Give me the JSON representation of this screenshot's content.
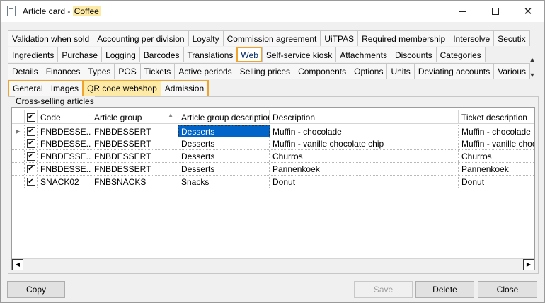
{
  "window": {
    "title_prefix": "Article card - ",
    "title_highlight": "Coffee"
  },
  "tabs": {
    "row1": [
      "Validation when sold",
      "Accounting per division",
      "Loyalty",
      "Commission agreement",
      "UiTPAS",
      "Required membership",
      "Intersolve",
      "Secutix"
    ],
    "row2": [
      "Ingredients",
      "Purchase",
      "Logging",
      "Barcodes",
      "Translations",
      "Web",
      "Self-service kiosk",
      "Attachments",
      "Discounts",
      "Categories"
    ],
    "row3": [
      "Details",
      "Finances",
      "Types",
      "POS",
      "Tickets",
      "Active periods",
      "Selling prices",
      "Components",
      "Options",
      "Units",
      "Deviating accounts",
      "Various"
    ],
    "active": "Web"
  },
  "subtabs": {
    "items": [
      "General",
      "Images",
      "QR code webshop",
      "Admission"
    ],
    "selected": "QR code webshop"
  },
  "group_label": "Cross-selling articles",
  "grid": {
    "columns": [
      "Code",
      "Article group",
      "Article group description",
      "Description",
      "Ticket description"
    ],
    "rows": [
      {
        "code": "FNBDESSE...",
        "group": "FNBDESSERT",
        "group_desc": "Desserts",
        "description": "Muffin - chocolade",
        "ticket": "Muffin - chocolade",
        "checked": true
      },
      {
        "code": "FNBDESSE...",
        "group": "FNBDESSERT",
        "group_desc": "Desserts",
        "description": "Muffin -  vanille chocolate chip",
        "ticket": "Muffin - vanille chocol",
        "checked": true
      },
      {
        "code": "FNBDESSE...",
        "group": "FNBDESSERT",
        "group_desc": "Desserts",
        "description": "Churros",
        "ticket": "Churros",
        "checked": true
      },
      {
        "code": "FNBDESSE...",
        "group": "FNBDESSERT",
        "group_desc": "Desserts",
        "description": "Pannenkoek",
        "ticket": "Pannenkoek",
        "checked": true
      },
      {
        "code": "SNACK02",
        "group": "FNBSNACKS",
        "group_desc": "Snacks",
        "description": "Donut",
        "ticket": "Donut",
        "checked": true
      }
    ]
  },
  "buttons": {
    "copy": "Copy",
    "save": "Save",
    "delete": "Delete",
    "close": "Close"
  },
  "colors": {
    "highlight_outline": "#f0a430",
    "highlight_fill": "#fdeaa6",
    "selection": "#0064c8"
  }
}
